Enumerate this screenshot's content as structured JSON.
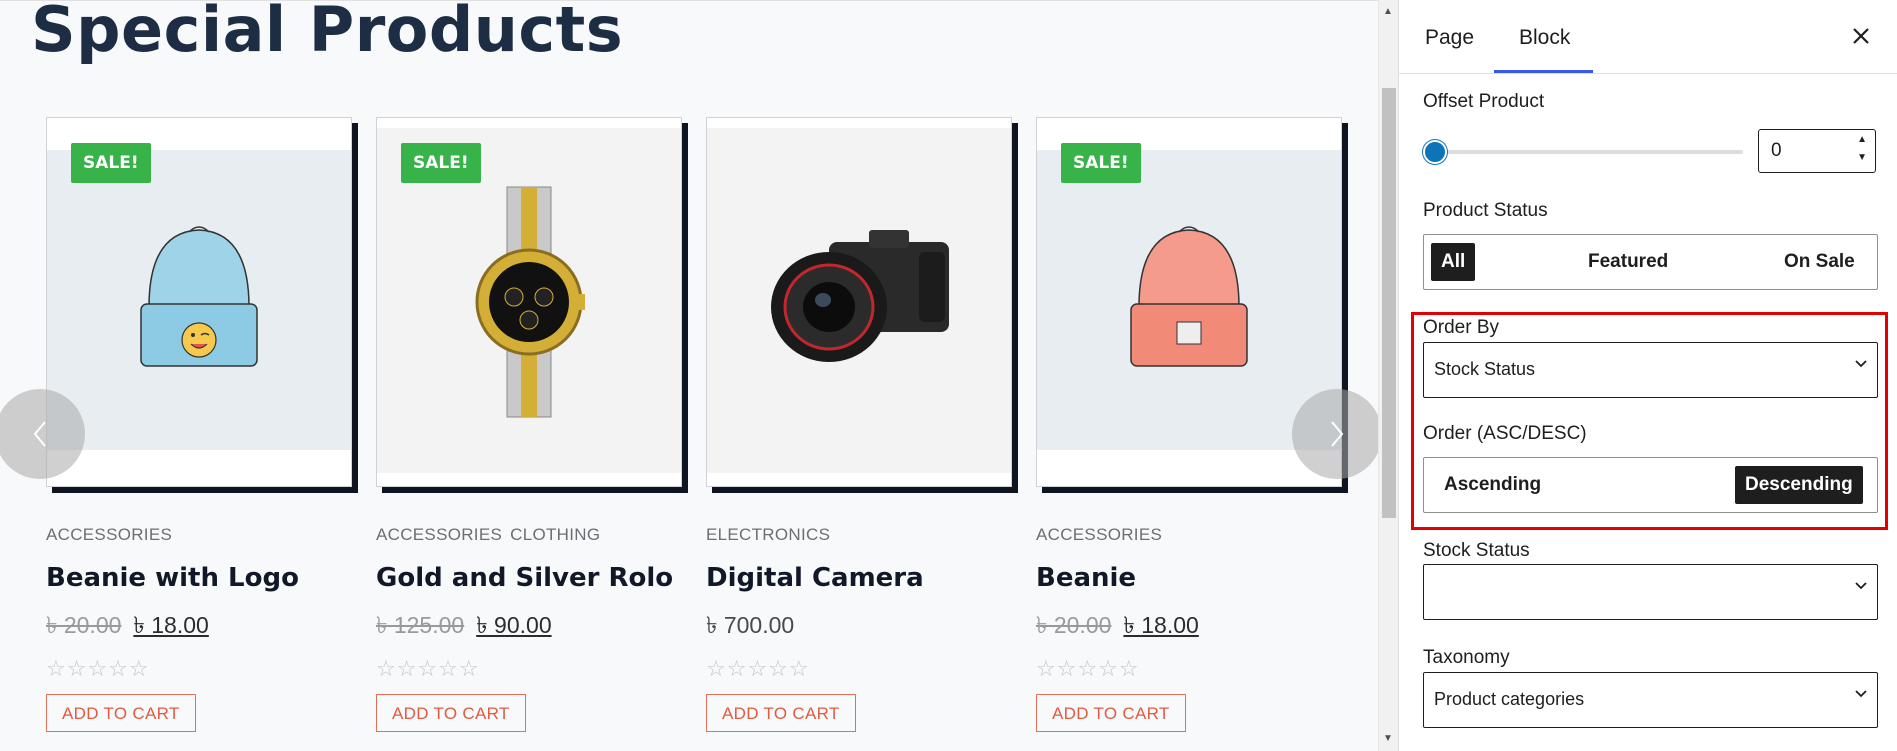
{
  "canvas": {
    "title": "Special Products",
    "products": [
      {
        "sale": "SALE!",
        "categories": [
          "ACCESSORIES"
        ],
        "name": "Beanie with Logo",
        "old_price": "৳ 20.00",
        "price": "৳ 18.00",
        "stars": "☆☆☆☆☆",
        "add_to_cart": "ADD TO CART",
        "image": "blue-beanie-with-logo"
      },
      {
        "sale": "SALE!",
        "categories": [
          "ACCESSORIES",
          "CLOTHING"
        ],
        "name": "Gold and Silver Rolo",
        "old_price": "৳ 125.00",
        "price": "৳ 90.00",
        "stars": "☆☆☆☆☆",
        "add_to_cart": "ADD TO CART",
        "image": "gold-silver-watch"
      },
      {
        "sale": "",
        "categories": [
          "ELECTRONICS"
        ],
        "name": "Digital Camera",
        "old_price": "",
        "price": "৳ 700.00",
        "stars": "☆☆☆☆☆",
        "add_to_cart": "ADD TO CART",
        "image": "dslr-camera"
      },
      {
        "sale": "SALE!",
        "categories": [
          "ACCESSORIES"
        ],
        "name": "Beanie",
        "old_price": "৳ 20.00",
        "price": "৳ 18.00",
        "stars": "☆☆☆☆☆",
        "add_to_cart": "ADD TO CART",
        "image": "orange-beanie"
      }
    ],
    "prev_icon": "chevron-left-icon",
    "next_icon": "chevron-right-icon"
  },
  "sidebar": {
    "tabs": [
      "Page",
      "Block"
    ],
    "active_tab": "Block",
    "close_icon": "close-icon",
    "offset": {
      "label": "Offset Product",
      "value": "0",
      "slider_fraction": 0
    },
    "product_status": {
      "label": "Product Status",
      "options": [
        "All",
        "Featured",
        "On Sale"
      ],
      "selected": "All"
    },
    "order_by": {
      "label": "Order By",
      "value": "Stock Status"
    },
    "order": {
      "label": "Order (ASC/DESC)",
      "options": [
        "Ascending",
        "Descending"
      ],
      "selected": "Descending"
    },
    "stock_status": {
      "label": "Stock Status",
      "value": ""
    },
    "taxonomy": {
      "label": "Taxonomy",
      "value": "Product categories"
    },
    "highlight_color": "#e30000",
    "accent_color": "#3858e9"
  }
}
